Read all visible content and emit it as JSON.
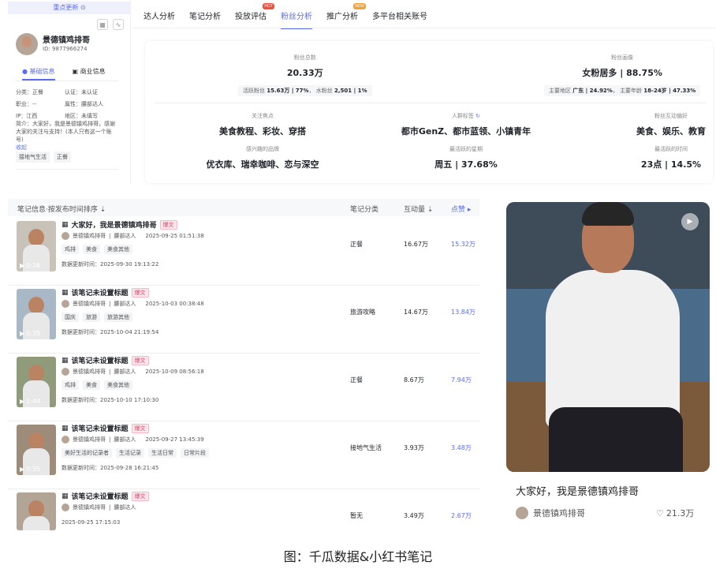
{
  "sidebar": {
    "top_banner": "重点更新 ⊙",
    "name": "景德镇鸡排哥",
    "id": "ID: 9877966274",
    "tabs": [
      "基础信息",
      "商业信息"
    ],
    "info": [
      [
        "分类：正餐",
        "认证：未认证"
      ],
      [
        "职业：--",
        "属性：腰部达人"
      ],
      [
        "IP：江西",
        "地区：未填写"
      ]
    ],
    "intro": "简介：大家好，我是景德镇鸡排哥，感谢大家的关注与支持！(本人只有这一个账号)",
    "intro_more": "收起",
    "tags": [
      "接地气生活",
      "正餐"
    ]
  },
  "nav": {
    "items": [
      "达人分析",
      "笔记分析",
      "投放评估",
      "粉丝分析",
      "推广分析",
      "多平台相关账号"
    ],
    "badges": {
      "2": "HOT",
      "4": "NEW"
    },
    "active": "粉丝分析"
  },
  "fans": {
    "total_label": "粉丝总数",
    "total_value": "20.33万",
    "total_sub_a_label": "活跃粉丝",
    "total_sub_a_value": "15.63万 | 77%",
    "total_sub_b_label": "水粉丝",
    "total_sub_b_value": "2,501 | 1%",
    "portrait_label": "粉丝画像",
    "portrait_value": "女粉居多 | 88.75%",
    "portrait_sub_a_label": "主要地区",
    "portrait_sub_a_value": "广东 | 24.92%",
    "portrait_sub_b_label": "主要年龄",
    "portrait_sub_b_value": "18-24岁 | 47.33%",
    "focus_label": "关注焦点",
    "focus_value": "美食教程、彩妆、穿搭",
    "crowd_label": "人群标签",
    "crowd_value": "都市GenZ、都市蓝领、小镇青年",
    "interact_label": "粉丝互动偏好",
    "interact_value": "美食、娱乐、教育",
    "brand_label": "感兴趣的品牌",
    "brand_value": "优衣库、瑞幸咖啡、恋与深空",
    "week_label": "最活跃的星期",
    "week_value": "周五 | 37.68%",
    "time_label": "最活跃的时间",
    "time_value": "23点 | 14.5%"
  },
  "table": {
    "headers": {
      "info": "笔记信息·按发布时间排序",
      "category": "笔记分类",
      "interact": "互动量",
      "likes": "点赞"
    },
    "rows": [
      {
        "title": "大家好，我是景德镇鸡排哥",
        "author": "景德镇鸡排哥",
        "level": "腰部达人",
        "date": "2025-09-25 01:51:38",
        "tags": [
          "鸡排",
          "美食",
          "美食其他"
        ],
        "update": "数据更新时间：2025-09-30 19:13:22",
        "duration": "0:26",
        "category": "正餐",
        "interact": "16.67万",
        "likes": "15.32万"
      },
      {
        "title": "该笔记未设置标题",
        "author": "景德镇鸡排哥",
        "level": "腰部达人",
        "date": "2025-10-03 00:38:48",
        "tags": [
          "国庆",
          "旅游",
          "旅游其他"
        ],
        "update": "数据更新时间：2025-10-04 21:19:54",
        "duration": "0:35",
        "category": "旅游攻略",
        "interact": "14.67万",
        "likes": "13.84万"
      },
      {
        "title": "该笔记未设置标题",
        "author": "景德镇鸡排哥",
        "level": "腰部达人",
        "date": "2025-10-09 08:56:18",
        "tags": [
          "鸡排",
          "美食",
          "美食其他"
        ],
        "update": "数据更新时间：2025-10-10 17:10:30",
        "duration": "1:44",
        "category": "正餐",
        "interact": "8.67万",
        "likes": "7.94万"
      },
      {
        "title": "该笔记未设置标题",
        "author": "景德镇鸡排哥",
        "level": "腰部达人",
        "date": "2025-09-27 13:45:39",
        "tags": [
          "美好生活的记录者",
          "生活记录",
          "生活日常",
          "日常片段"
        ],
        "update": "数据更新时间：2025-09-28 16:21:45",
        "duration": "0:35",
        "category": "接地气生活",
        "interact": "3.93万",
        "likes": "3.48万"
      },
      {
        "title": "该笔记未设置标题",
        "author": "景德镇鸡排哥",
        "level": "腰部达人",
        "date": "",
        "tags": [],
        "update": "2025-09-25 17:15:03",
        "duration": "",
        "category": "暂无",
        "interact": "3.49万",
        "likes": "2.67万"
      }
    ],
    "baowen": "爆文"
  },
  "xhs": {
    "title": "大家好，我是景德镇鸡排哥",
    "author": "景德镇鸡排哥",
    "likes": "21.3万"
  },
  "caption": "图：千瓜数据&小红书笔记"
}
